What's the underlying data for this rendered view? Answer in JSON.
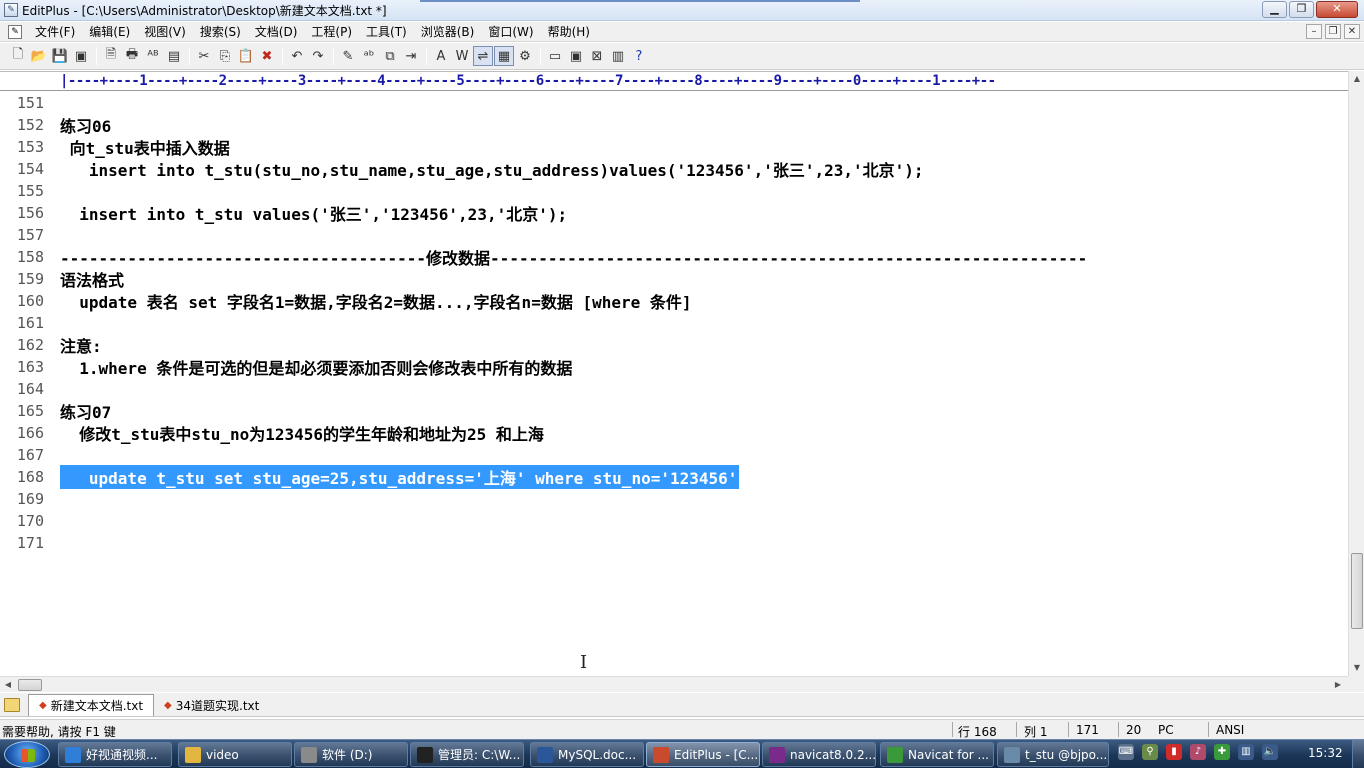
{
  "window": {
    "title": "EditPlus - [C:\\Users\\Administrator\\Desktop\\新建文本文档.txt *]",
    "minimize": "▁",
    "maximize": "❐",
    "close": "✕"
  },
  "menu": {
    "items": [
      "文件(F)",
      "编辑(E)",
      "视图(V)",
      "搜索(S)",
      "文档(D)",
      "工程(P)",
      "工具(T)",
      "浏览器(B)",
      "窗口(W)",
      "帮助(H)"
    ],
    "mdi_minimize": "–",
    "mdi_restore": "❐",
    "mdi_close": "✕"
  },
  "toolbar": {
    "icons": [
      "new-file-icon",
      "open-folder-icon",
      "save-icon",
      "save-all-icon",
      "print-preview-icon",
      "print-icon",
      "spell-check-icon",
      "document-icon",
      "cut-icon",
      "copy-icon",
      "paste-icon",
      "delete-icon",
      "undo-icon",
      "redo-icon",
      "find-icon",
      "replace-icon",
      "find-in-files-icon",
      "goto-line-icon",
      "font-icon",
      "word-wrap-icon",
      "indent-guide-icon",
      "column-mode-icon",
      "settings-icon",
      "browser-icon",
      "ftp-icon",
      "html-toolbar-icon",
      "cliptext-icon",
      "help-icon"
    ],
    "glyphs": [
      "🗋",
      "📂",
      "💾",
      "▣",
      "🗎",
      "🖶",
      "ᴬᴮ",
      "▤",
      "✂",
      "⎘",
      "📋",
      "✖",
      "↶",
      "↷",
      "✎",
      "ᵃᵇ",
      "⧉",
      "⇥",
      "A",
      "W",
      "⇌",
      "▦",
      "⚙",
      "▭",
      "▣",
      "⊠",
      "▥",
      "?"
    ],
    "active_index": 20,
    "active_index2": 21
  },
  "ruler": {
    "text": "|----+----1----+----2----+----3----+----4----+----5----+----6----+----7----+----8----+----9----+----0----+----1----+--"
  },
  "editor": {
    "lines": [
      {
        "num": "151",
        "text": ""
      },
      {
        "num": "152",
        "text": "练习06"
      },
      {
        "num": "153",
        "text": " 向t_stu表中插入数据"
      },
      {
        "num": "154",
        "text": "   insert into t_stu(stu_no,stu_name,stu_age,stu_address)values('123456','张三',23,'北京');"
      },
      {
        "num": "155",
        "text": ""
      },
      {
        "num": "156",
        "text": "  insert into t_stu values('张三','123456',23,'北京');"
      },
      {
        "num": "157",
        "text": ""
      },
      {
        "num": "158",
        "text": "--------------------------------------修改数据--------------------------------------------------------------"
      },
      {
        "num": "159",
        "text": "语法格式"
      },
      {
        "num": "160",
        "text": "  update 表名 set 字段名1=数据,字段名2=数据...,字段名n=数据 [where 条件]"
      },
      {
        "num": "161",
        "text": ""
      },
      {
        "num": "162",
        "text": "注意:"
      },
      {
        "num": "163",
        "text": "  1.where 条件是可选的但是却必须要添加否则会修改表中所有的数据"
      },
      {
        "num": "164",
        "text": ""
      },
      {
        "num": "165",
        "text": "练习07"
      },
      {
        "num": "166",
        "text": "  修改t_stu表中stu_no为123456的学生年龄和地址为25 和上海"
      },
      {
        "num": "167",
        "text": ""
      },
      {
        "num": "168",
        "text": "   update t_stu set stu_age=25,stu_address='上海' where stu_no='123456'",
        "selected": true
      },
      {
        "num": "169",
        "text": ""
      },
      {
        "num": "170",
        "text": ""
      },
      {
        "num": "171",
        "text": ""
      }
    ]
  },
  "tabs": [
    {
      "label": "新建文本文档.txt",
      "active": true
    },
    {
      "label": "34道题实现.txt",
      "active": false
    }
  ],
  "status": {
    "help": "需要帮助, 请按 F1 键",
    "row": "行 168",
    "col": "列 1",
    "total": "171",
    "count": "20",
    "mode": "PC",
    "encoding": "ANSI"
  },
  "taskbar": {
    "items": [
      {
        "label": "好视通视频...",
        "icon": "video-conference-icon",
        "color": "#2f7fd8"
      },
      {
        "label": "video",
        "icon": "folder-icon",
        "color": "#e2b640"
      },
      {
        "label": "软件 (D:)",
        "icon": "drive-icon",
        "color": "#8a8a8a"
      },
      {
        "label": "管理员: C:\\W...",
        "icon": "cmd-icon",
        "color": "#222222"
      },
      {
        "label": "MySQL.doc...",
        "icon": "word-icon",
        "color": "#2b579a"
      },
      {
        "label": "EditPlus - [C...",
        "icon": "editplus-icon",
        "color": "#c94a2c"
      },
      {
        "label": "navicat8.0.2...",
        "icon": "winrar-icon",
        "color": "#7a2a8a"
      },
      {
        "label": "Navicat for ...",
        "icon": "navicat-icon",
        "color": "#3a9a3a"
      },
      {
        "label": "t_stu @bjpo...",
        "icon": "table-icon",
        "color": "#6a8aaa"
      }
    ],
    "clock": "15:32"
  }
}
